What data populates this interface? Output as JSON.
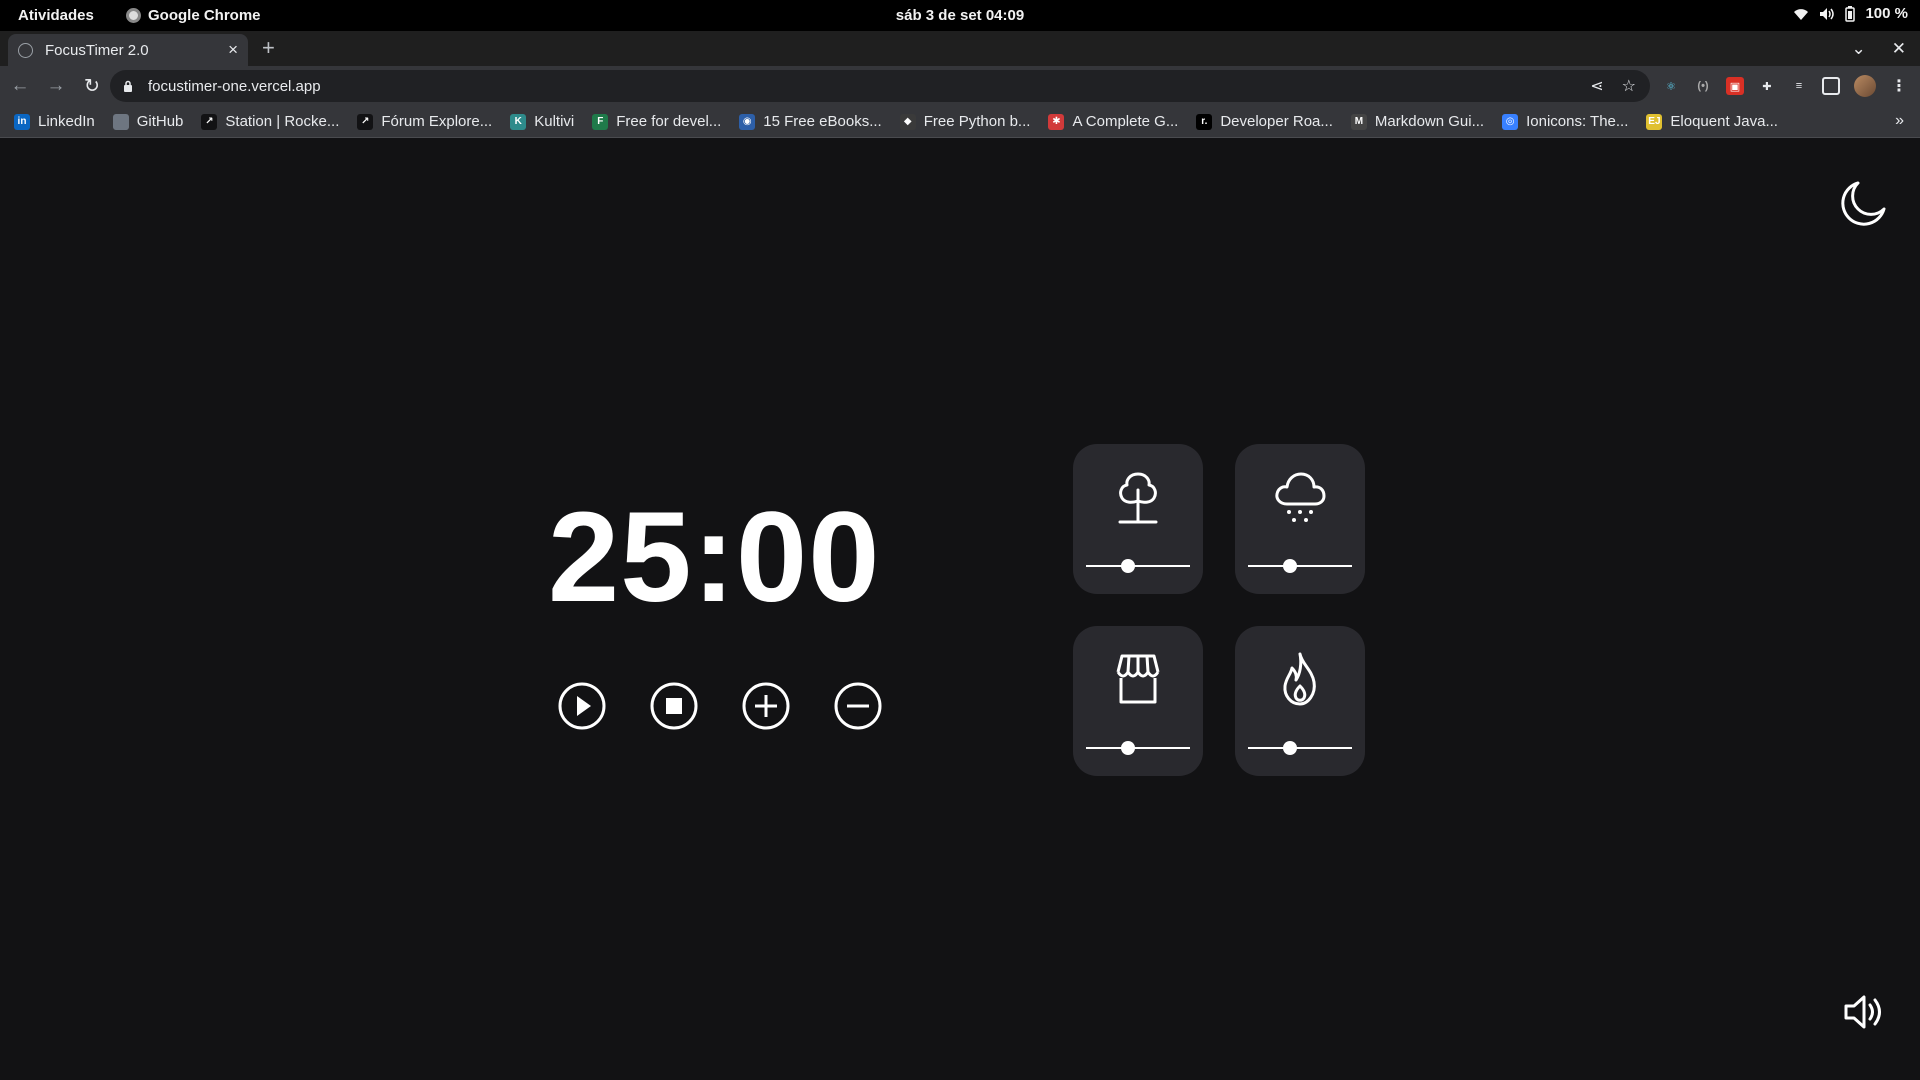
{
  "os": {
    "activities": "Atividades",
    "app_name": "Google Chrome",
    "clock": "sáb 3 de set  04:09",
    "battery": "100 %"
  },
  "browser": {
    "tab_title": "FocusTimer 2.0",
    "tab_close": "×",
    "new_tab": "+",
    "url": "focustimer-one.vercel.app",
    "bookmarks": [
      {
        "label": "LinkedIn",
        "icon": "linkedin-icon",
        "color": "#0a66c2",
        "glyph": "in"
      },
      {
        "label": "GitHub",
        "icon": "github-icon",
        "color": "#6e7681",
        "glyph": ""
      },
      {
        "label": "Station | Rocke...",
        "icon": "rocketseat-icon",
        "color": "#121214",
        "glyph": "↗"
      },
      {
        "label": "Fórum Explore...",
        "icon": "rocketseat-icon",
        "color": "#121214",
        "glyph": "↗"
      },
      {
        "label": "Kultivi",
        "icon": "kultivi-icon",
        "color": "#2e8b8b",
        "glyph": "K"
      },
      {
        "label": "Free for devel...",
        "icon": "f-icon",
        "color": "#1f7a4a",
        "glyph": "F"
      },
      {
        "label": "15 Free eBooks...",
        "icon": "ebook-icon",
        "color": "#2d5fa8",
        "glyph": "◉"
      },
      {
        "label": "Free Python b...",
        "icon": "python-icon",
        "color": "#3a3a3a",
        "glyph": "◆"
      },
      {
        "label": "A Complete G...",
        "icon": "asterisk-icon",
        "color": "#d13a3a",
        "glyph": "✱"
      },
      {
        "label": "Developer Roa...",
        "icon": "roadmap-icon",
        "color": "#000000",
        "glyph": "r."
      },
      {
        "label": "Markdown Gui...",
        "icon": "markdown-icon",
        "color": "#444444",
        "glyph": "M"
      },
      {
        "label": "Ionicons: The...",
        "icon": "ionicons-icon",
        "color": "#3880ff",
        "glyph": "◎"
      },
      {
        "label": "Eloquent Java...",
        "icon": "js-icon",
        "color": "#e0c030",
        "glyph": "EJ"
      }
    ],
    "bookmarks_more": "»"
  },
  "app": {
    "timer": "25:00",
    "controls": [
      {
        "name": "play-button",
        "icon": "play-icon"
      },
      {
        "name": "stop-button",
        "icon": "stop-icon"
      },
      {
        "name": "add-time-button",
        "icon": "plus-circle-icon"
      },
      {
        "name": "remove-time-button",
        "icon": "minus-circle-icon"
      }
    ],
    "sounds": [
      {
        "name": "forest",
        "icon": "tree-icon",
        "volume": 0.4
      },
      {
        "name": "rain",
        "icon": "rain-cloud-icon",
        "volume": 0.4
      },
      {
        "name": "coffee-shop",
        "icon": "storefront-icon",
        "volume": 0.4
      },
      {
        "name": "fireplace",
        "icon": "flame-icon",
        "volume": 0.4
      }
    ],
    "colors": {
      "background": "#121214",
      "card": "#29292e",
      "foreground": "#ffffff"
    }
  }
}
